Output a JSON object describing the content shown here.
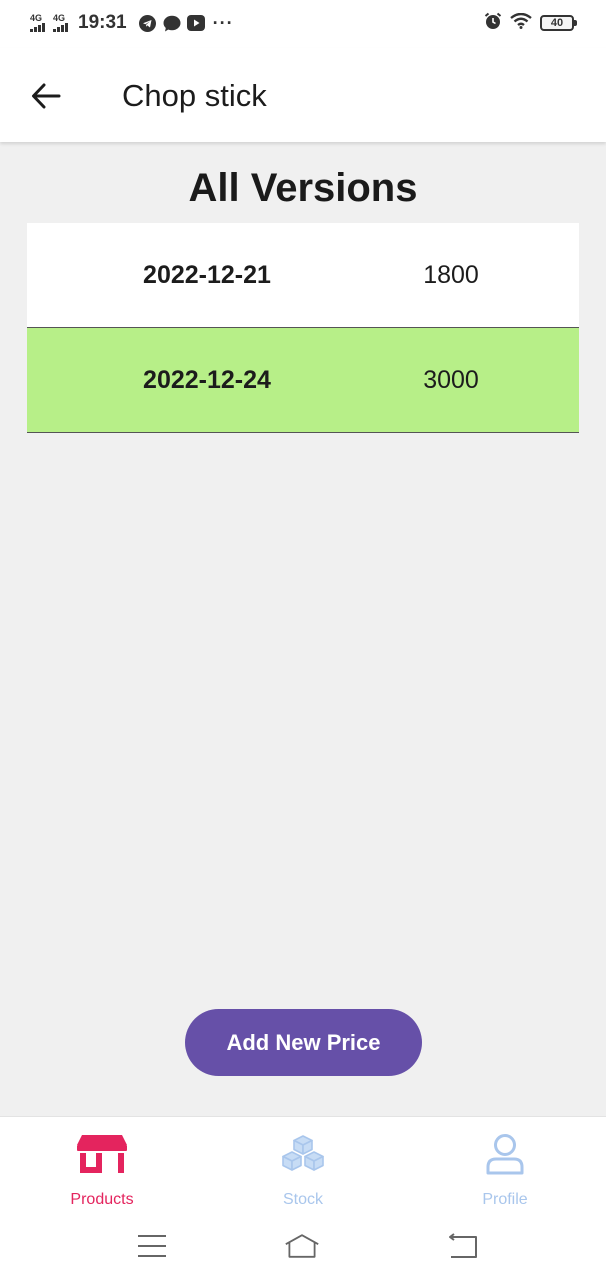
{
  "status_bar": {
    "net1": "4G",
    "net2": "4G",
    "time": "19:31",
    "dots": "···",
    "battery": "40"
  },
  "app_bar": {
    "title": "Chop stick"
  },
  "section": {
    "title": "All Versions"
  },
  "versions": [
    {
      "date": "2022-12-21",
      "price": "1800",
      "highlight": false
    },
    {
      "date": "2022-12-24",
      "price": "3000",
      "highlight": true
    }
  ],
  "actions": {
    "add_price_label": "Add New Price"
  },
  "bottom_nav": {
    "items": [
      {
        "label": "Products",
        "icon": "store-icon",
        "active": true
      },
      {
        "label": "Stock",
        "icon": "boxes-icon",
        "active": false
      },
      {
        "label": "Profile",
        "icon": "person-icon",
        "active": false
      }
    ]
  },
  "colors": {
    "accent": "#6650a8",
    "active_nav": "#e4245e",
    "inactive_nav": "#a9c6ec",
    "highlight_row": "#b7ef88"
  }
}
